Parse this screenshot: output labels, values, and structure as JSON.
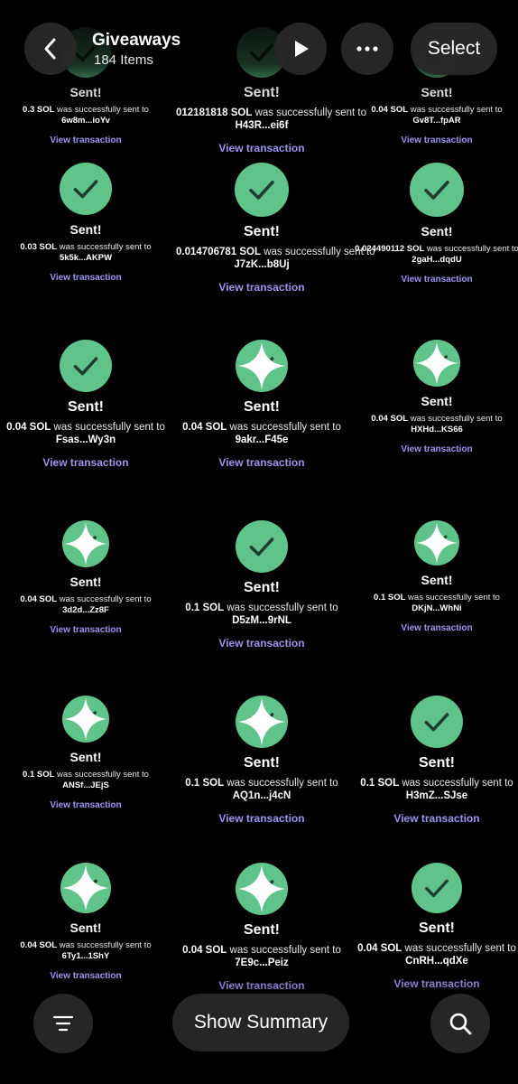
{
  "header": {
    "title": "Giveaways",
    "count": "184 Items",
    "select_label": "Select",
    "back_icon": "chevron-left-icon",
    "play_icon": "play-icon",
    "more_icon": "more-horizontal-icon"
  },
  "footer": {
    "summary_label": "Show Summary",
    "filter_icon": "filter-icon",
    "search_icon": "search-icon"
  },
  "colors": {
    "check": "#5fc38a",
    "link": "#9d94f0",
    "background": "#000000"
  },
  "sent_label": "Sent!",
  "success_text": "was successfully sent to",
  "link_label": "View transaction",
  "items": [
    {
      "status": "Sent!",
      "amount": "0.3 SOL",
      "recipient": "6w8m...ioYv",
      "link": "View transaction",
      "sparkle": false
    },
    {
      "status": "Sent!",
      "amount": "012181818 SOL",
      "recipient": "H43R...ei6f",
      "link": "View transaction",
      "sparkle": false
    },
    {
      "status": "Sent!",
      "amount": "0.04 SOL",
      "recipient": "Gv8T...fpAR",
      "link": "View transaction",
      "sparkle": false
    },
    {
      "status": "Sent!",
      "amount": "0.03 SOL",
      "recipient": "5k5k...AKPW",
      "link": "View transaction",
      "sparkle": false
    },
    {
      "status": "Sent!",
      "amount": "0.014706781 SOL",
      "recipient": "J7zK...b8Uj",
      "link": "View transaction",
      "sparkle": false
    },
    {
      "status": "Sent!",
      "amount": "0.024490112 SOL",
      "recipient": "2gaH...dqdU",
      "link": "View transaction",
      "sparkle": false
    },
    {
      "status": "Sent!",
      "amount": "0.04 SOL",
      "recipient": "Fsas...Wy3n",
      "link": "View transaction",
      "sparkle": false
    },
    {
      "status": "Sent!",
      "amount": "0.04 SOL",
      "recipient": "9akr...F45e",
      "link": "View transaction",
      "sparkle": true
    },
    {
      "status": "Sent!",
      "amount": "0.04 SOL",
      "recipient": "HXHd...KS66",
      "link": "View transaction",
      "sparkle": true
    },
    {
      "status": "Sent!",
      "amount": "0.04 SOL",
      "recipient": "3d2d...Zz8F",
      "link": "View transaction",
      "sparkle": true
    },
    {
      "status": "Sent!",
      "amount": "0.1 SOL",
      "recipient": "D5zM...9rNL",
      "link": "View transaction",
      "sparkle": false
    },
    {
      "status": "Sent!",
      "amount": "0.1 SOL",
      "recipient": "DKjN...WhNi",
      "link": "View transaction",
      "sparkle": true
    },
    {
      "status": "Sent!",
      "amount": "0.1 SOL",
      "recipient": "ANSf...JEjS",
      "link": "View transaction",
      "sparkle": true
    },
    {
      "status": "Sent!",
      "amount": "0.1 SOL",
      "recipient": "AQ1n...j4cN",
      "link": "View transaction",
      "sparkle": true
    },
    {
      "status": "Sent!",
      "amount": "0.1 SOL",
      "recipient": "H3mZ...SJse",
      "link": "View transaction",
      "sparkle": false
    },
    {
      "status": "Sent!",
      "amount": "0.04 SOL",
      "recipient": "6Ty1...1ShY",
      "link": "View transaction",
      "sparkle": true
    },
    {
      "status": "Sent!",
      "amount": "0.04 SOL",
      "recipient": "7E9c...Peiz",
      "link": "View transaction",
      "sparkle": true
    },
    {
      "status": "Sent!",
      "amount": "0.04 SOL",
      "recipient": "CnRH...qdXe",
      "link": "View transaction",
      "sparkle": false
    }
  ]
}
